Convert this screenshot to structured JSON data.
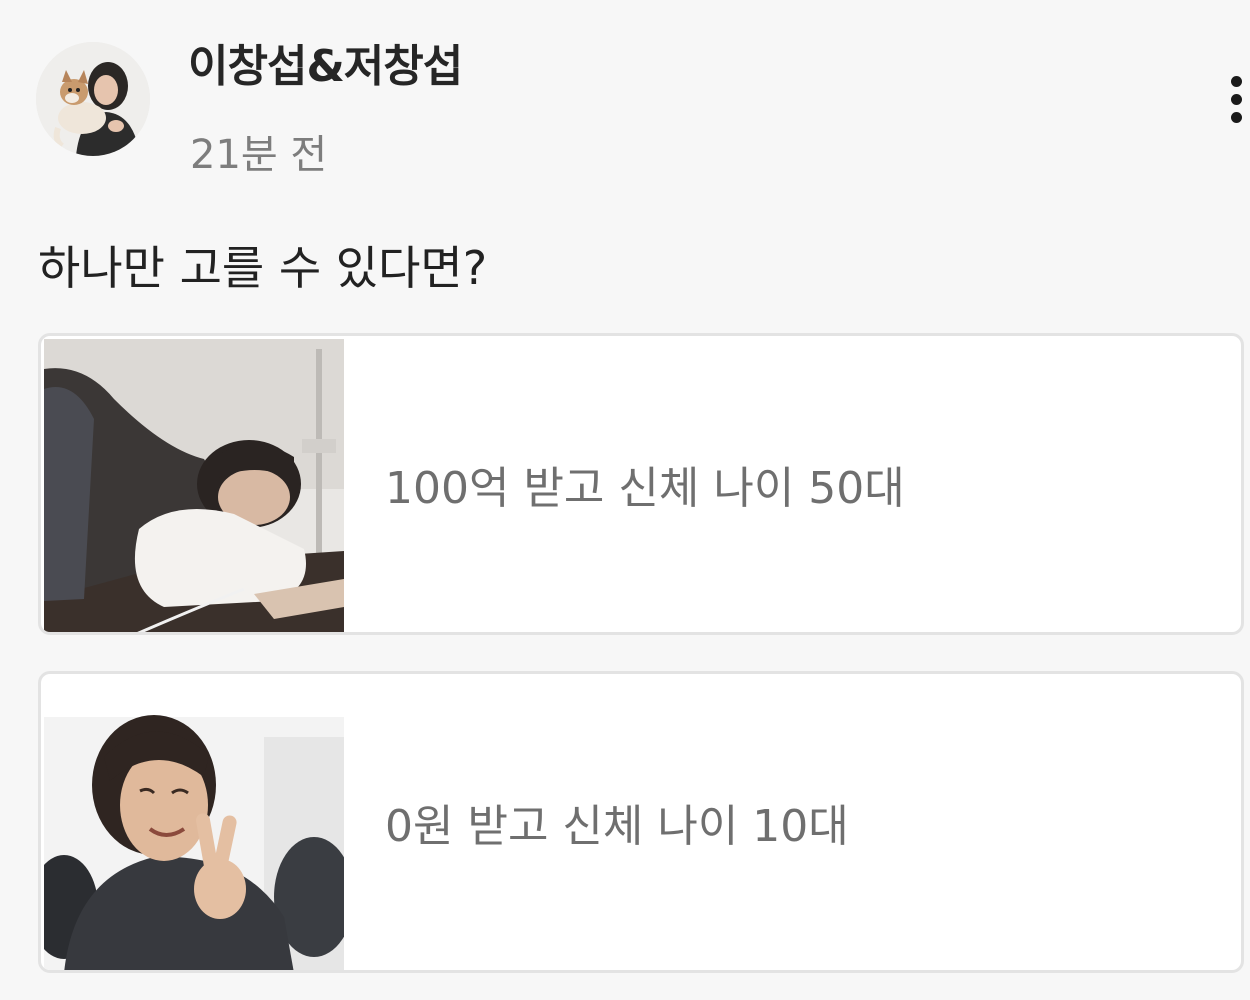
{
  "post": {
    "author": "이창섭&저창섭",
    "time": "21분 전",
    "question": "하나만 고를 수 있다면?"
  },
  "icons": {
    "more": "more-vertical-icon"
  },
  "options": [
    {
      "label": "100억 받고 신체 나이 50대",
      "image": "person-sleeping-at-desk-photo"
    },
    {
      "label": "0원 받고 신체 나이 10대",
      "image": "person-making-peace-sign-photo"
    }
  ]
}
